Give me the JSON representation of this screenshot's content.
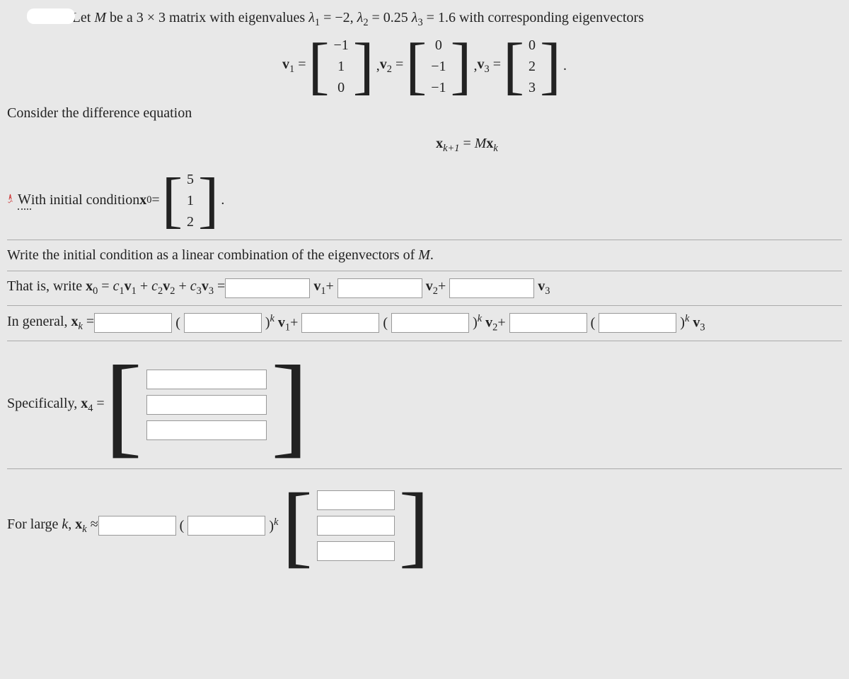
{
  "problem": {
    "intro_pre": "Let ",
    "M": "M",
    "intro_mid": " be a 3 × 3 matrix with eigenvalues ",
    "lambda1_lhs": "λ",
    "lambda1_sub": "1",
    "lambda1_rhs": " = −2, ",
    "lambda2_lhs": "λ",
    "lambda2_sub": "2",
    "lambda2_rhs": " = 0.25 ",
    "lambda3_lhs": "λ",
    "lambda3_sub": "3",
    "lambda3_rhs": " = 1.6 with corresponding eigenvectors",
    "v1_label": "v",
    "v1_sub": "1",
    "eq": " = ",
    "comma": ", ",
    "v2_label": "v",
    "v2_sub": "2",
    "v3_label": "v",
    "v3_sub": "3",
    "period": ".",
    "v1": [
      "−1",
      "1",
      "0"
    ],
    "v2": [
      "0",
      "−1",
      "−1"
    ],
    "v3": [
      "0",
      "2",
      "3"
    ],
    "consider": "Consider the difference equation",
    "diff_eq": "x",
    "diff_sub1": "k+1",
    "diff_eq2": " = ",
    "diff_M": "M",
    "diff_x2": "x",
    "diff_sub2": "k",
    "with_label": "ith initial condition ",
    "x0_label": "x",
    "x0_sub": "0",
    "x0": [
      "5",
      "1",
      "2"
    ]
  },
  "q1": {
    "prompt": "Write the initial condition as a linear combination of the eigenvectors of ",
    "M": "M",
    "period": ".",
    "that_is": "That is, write ",
    "expr": "x",
    "x0_sub": "0",
    "equals": " = ",
    "c1": "c",
    "c1_sub": "1",
    "v1": "v",
    "v1_sub": "1",
    "plus": " + ",
    "c2": "c",
    "c2_sub": "2",
    "v2": "v",
    "v2_sub": "2",
    "c3": "c",
    "c3_sub": "3",
    "v3": "v",
    "v3_sub": "3",
    "eq2": " = ",
    "v1b": "v",
    "v1b_sub": "1",
    "plus_s": "+",
    "v2b": "v",
    "v2b_sub": "2",
    "v3b": "v",
    "v3b_sub": "3"
  },
  "q2": {
    "label": "In general, ",
    "xk": "x",
    "xk_sub": "k",
    "eq": " = ",
    "lparen": "(",
    "rparen": ")",
    "k": "k",
    "v1": "v",
    "v1_sub": "1",
    "plus": "+",
    "v2": "v",
    "v2_sub": "2",
    "v3": "v",
    "v3_sub": "3"
  },
  "q3": {
    "label": "Specifically, ",
    "x4": "x",
    "x4_sub": "4",
    "eq": " = "
  },
  "q4": {
    "label": "For large ",
    "k": "k",
    "comma": ", ",
    "xk": "x",
    "xk_sub": "k",
    "approx": " ≈ ",
    "lparen": "(",
    "rparen": ")",
    "ksup": "k"
  }
}
